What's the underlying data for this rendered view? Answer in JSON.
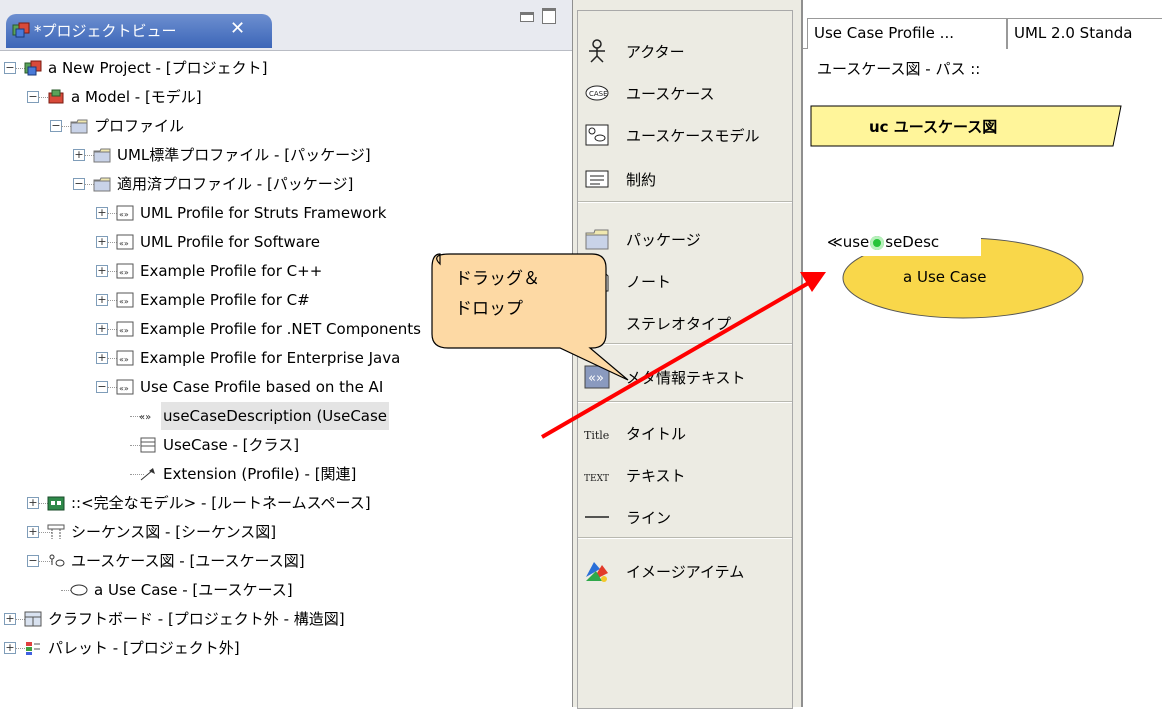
{
  "project_view": {
    "tab_title": "*プロジェクトビュー",
    "close_glyph": "✕",
    "tree": [
      {
        "label": "a New Project - [プロジェクト]",
        "icon": "project-icon",
        "toggle": "minus"
      },
      {
        "label": "a Model - [モデル]",
        "icon": "model-icon",
        "toggle": "minus"
      },
      {
        "label": "プロファイル",
        "icon": "folder-icon",
        "toggle": "minus"
      },
      {
        "label": "UML標準プロファイル - [パッケージ]",
        "icon": "folder-icon",
        "toggle": "plus"
      },
      {
        "label": "適用済プロファイル - [パッケージ]",
        "icon": "folder-icon",
        "toggle": "minus"
      },
      {
        "label": "UML Profile for Struts Framework",
        "icon": "profile-icon",
        "toggle": "plus"
      },
      {
        "label": "UML Profile for Software",
        "icon": "profile-icon",
        "toggle": "plus"
      },
      {
        "label": "Example Profile for C++",
        "icon": "profile-icon",
        "toggle": "plus"
      },
      {
        "label": "Example Profile for C#",
        "icon": "profile-icon",
        "toggle": "plus"
      },
      {
        "label": "Example Profile for .NET Components",
        "icon": "profile-icon",
        "toggle": "plus"
      },
      {
        "label": "Example Profile for Enterprise Java",
        "icon": "profile-icon",
        "toggle": "plus"
      },
      {
        "label": "Use Case Profile based on the AI",
        "icon": "profile-icon",
        "toggle": "minus"
      },
      {
        "label": "useCaseDescription (UseCase",
        "icon": "stereotype-icon",
        "toggle": "none"
      },
      {
        "label": "UseCase - [クラス]",
        "icon": "class-icon",
        "toggle": "none"
      },
      {
        "label": "Extension (Profile) - [関連]",
        "icon": "extension-icon",
        "toggle": "none"
      },
      {
        "label": "::<完全なモデル> - [ルートネームスペース]",
        "icon": "namespace-icon",
        "toggle": "plus"
      },
      {
        "label": "シーケンス図 - [シーケンス図]",
        "icon": "sequence-diagram-icon",
        "toggle": "plus"
      },
      {
        "label": "ユースケース図 - [ユースケース図]",
        "icon": "usecase-diagram-icon",
        "toggle": "minus"
      },
      {
        "label": "a Use Case - [ユースケース]",
        "icon": "usecase-icon",
        "toggle": "none"
      },
      {
        "label": "クラフトボード - [プロジェクト外 - 構造図]",
        "icon": "craftboard-icon",
        "toggle": "plus"
      },
      {
        "label": "パレット - [プロジェクト外]",
        "icon": "palette-icon",
        "toggle": "plus"
      }
    ]
  },
  "palette": {
    "items": [
      {
        "label": "アクター",
        "icon": "actor-icon"
      },
      {
        "label": "ユースケース",
        "icon": "usecase-icon"
      },
      {
        "label": "ユースケースモデル",
        "icon": "usecase-model-icon"
      },
      {
        "label": "制約",
        "icon": "constraint-icon"
      },
      {
        "label": "パッケージ",
        "icon": "package-icon"
      },
      {
        "label": "ノート",
        "icon": "note-icon"
      },
      {
        "label": "ステレオタイプ",
        "icon": "stereotype-icon"
      },
      {
        "label": "メタ情報テキスト",
        "icon": "meta-info-text-icon"
      },
      {
        "label": "タイトル",
        "icon": "title-icon"
      },
      {
        "label": "テキスト",
        "icon": "text-icon"
      },
      {
        "label": "ライン",
        "icon": "line-icon"
      },
      {
        "label": "イメージアイテム",
        "icon": "image-item-icon"
      }
    ],
    "case_badge": "CASE",
    "title_badge": "Title",
    "text_badge": "TEXT"
  },
  "editor": {
    "tabs": [
      "Use Case Profile ...",
      "UML 2.0 Standa"
    ],
    "path": "ユースケース図 - パス ::",
    "frame_label": "uc ユースケース図",
    "stereotype_prefix": "≪use",
    "stereotype_suffix": "seDesc",
    "usecase_name": "a Use Case"
  },
  "callout": {
    "line1": "ドラッグ＆",
    "line2": "ドロップ"
  },
  "colors": {
    "tab_active": "#3c66b8",
    "usecase_fill": "#f9d74a",
    "frame_fill": "#fff59a",
    "callout_fill": "#fdd9a4",
    "arrow": "#ff0000",
    "palette_bg": "#ecebe3"
  }
}
